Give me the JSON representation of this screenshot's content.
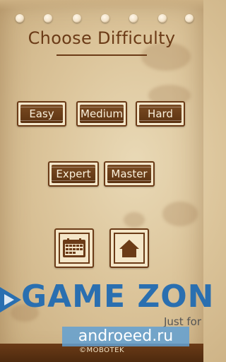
{
  "screen": {
    "title": "Choose Difficulty"
  },
  "difficulty_buttons": [
    {
      "label": "Easy"
    },
    {
      "label": "Medium"
    },
    {
      "label": "Hard"
    },
    {
      "label": "Expert"
    },
    {
      "label": "Master"
    }
  ],
  "icon_buttons": [
    {
      "icon": "calendar-icon"
    },
    {
      "icon": "home-icon"
    }
  ],
  "banner": {
    "text": "GAME ZON",
    "subtext": "Just for"
  },
  "watermark": {
    "text": "androeed.ru"
  },
  "footer": {
    "copyright": "©MOBOTEK"
  },
  "colors": {
    "primary_brown": "#6b3b17",
    "paper": "#e9d9b6",
    "button_face": "#f4e6c8",
    "banner_blue": "#2a6fb0"
  }
}
